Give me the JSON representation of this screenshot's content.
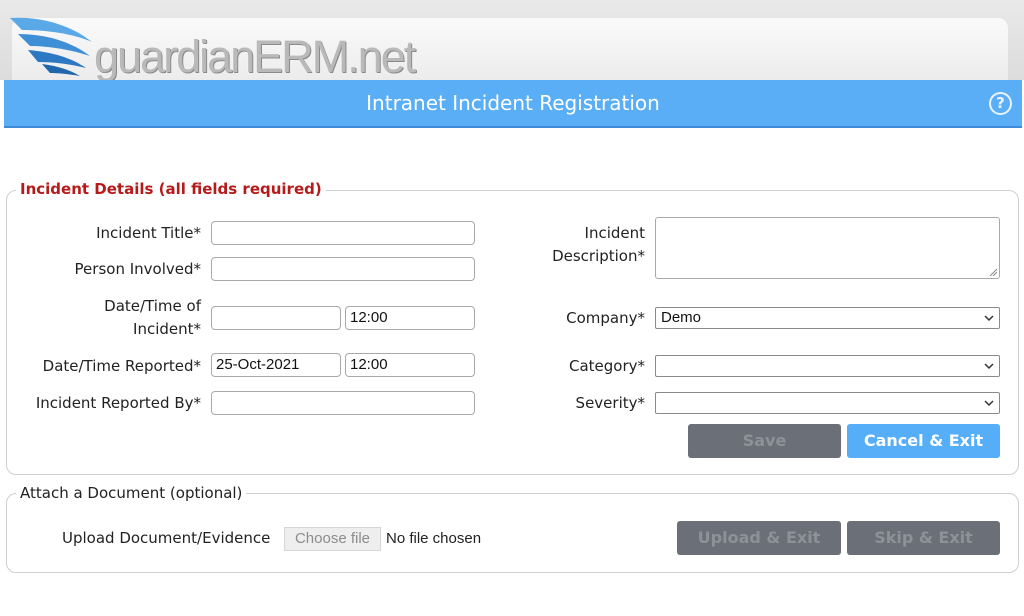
{
  "header": {
    "logo_text": "guardianERM.net",
    "title": "Intranet Incident Registration",
    "help_icon": "help-icon",
    "colors": {
      "titlebar": "#5aaef6",
      "legend_red": "#b61a1a",
      "button_blue": "#55aef7",
      "button_grey": "#6b6f77"
    }
  },
  "details": {
    "legend": "Incident Details (all fields required)",
    "incident_title_label": "Incident Title*",
    "incident_title_value": "",
    "person_involved_label": "Person Involved*",
    "person_involved_value": "",
    "date_incident_label_line1": "Date/Time of",
    "date_incident_label_line2": "Incident*",
    "date_incident_value": "",
    "time_incident_value": "12:00",
    "date_reported_label": "Date/Time Reported*",
    "date_reported_value": "25-Oct-2021",
    "time_reported_value": "12:00",
    "reported_by_label": "Incident Reported By*",
    "reported_by_value": "",
    "description_label_line1": "Incident",
    "description_label_line2": "Description*",
    "description_value": "",
    "company_label": "Company*",
    "company_value": "Demo",
    "category_label": "Category*",
    "category_value": "",
    "severity_label": "Severity*",
    "severity_value": "",
    "save_label": "Save",
    "cancel_label": "Cancel & Exit"
  },
  "attach": {
    "legend": "Attach a Document (optional)",
    "upload_label": "Upload Document/Evidence",
    "choose_file_label": "Choose file",
    "file_status": "No file chosen",
    "upload_exit_label": "Upload & Exit",
    "skip_exit_label": "Skip & Exit"
  }
}
